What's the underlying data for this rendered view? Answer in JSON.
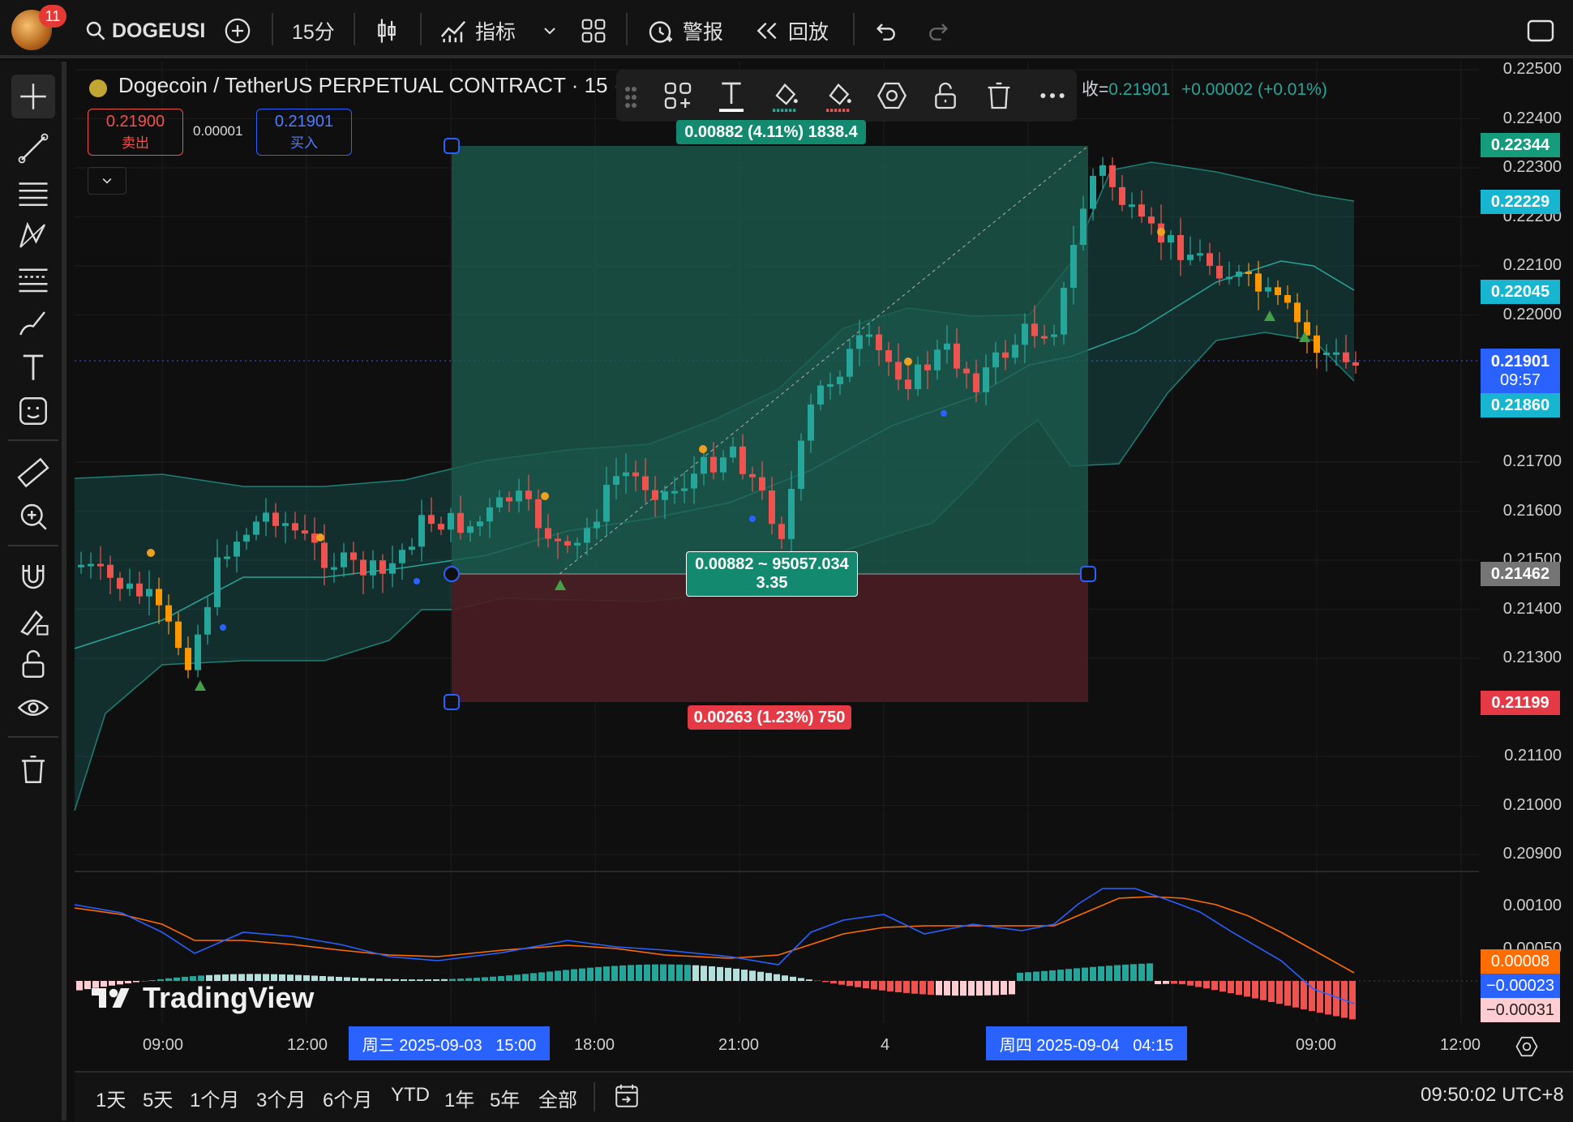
{
  "topbar": {
    "notification_count": "11",
    "symbol": "DOGEUSI",
    "interval": "15分",
    "indicators_label": "指标",
    "alert_label": "警报",
    "replay_label": "回放"
  },
  "legend": {
    "title": "Dogecoin / TetherUS PERPETUAL CONTRACT · 15 ·",
    "close_prefix": "收=",
    "close_value": "0.21901",
    "change": "+0.00002 (+0.01%)",
    "sell_price": "0.21900",
    "sell_label": "卖出",
    "spread": "0.00001",
    "buy_price": "0.21901",
    "buy_label": "买入"
  },
  "position_tool": {
    "target_label": "0.00882 (4.11%) 1838.4",
    "center_label_line1": "0.00882 ~ 95057.034",
    "center_label_line2": "3.35",
    "stop_label": "0.00263 (1.23%) 750"
  },
  "price_axis": {
    "ticks": [
      "0.22500",
      "0.22400",
      "0.22300",
      "0.22200",
      "0.22100",
      "0.22000",
      "0.21700",
      "0.21600",
      "0.21500",
      "0.21400",
      "0.21300",
      "0.21100",
      "0.21000",
      "0.20900"
    ],
    "tags": {
      "target": "0.22344",
      "bb_upper": "0.22229",
      "bb_mid": "0.22045",
      "last": "0.21901",
      "countdown": "09:57",
      "bb_lower": "0.21860",
      "entry": "0.21462",
      "stop": "0.21199"
    }
  },
  "macd_axis": {
    "ticks": [
      "0.00100",
      "0.00050"
    ],
    "tags": {
      "signal": "0.00008",
      "macd": "−0.00023",
      "hist": "−0.00031"
    }
  },
  "watermark": "TradingView",
  "time_axis": {
    "labels": [
      "09:00",
      "12:00",
      "18:00",
      "21:00",
      "4",
      "09:00",
      "12:00"
    ],
    "range_start": "周三 2025-09-03   15:00",
    "range_end": "周四 2025-09-04   04:15"
  },
  "bottombar": {
    "ranges": [
      "1天",
      "5天",
      "1个月",
      "3个月",
      "6个月",
      "YTD",
      "1年",
      "5年",
      "全部"
    ],
    "clock": "09:50:02 UTC+8"
  },
  "colors": {
    "up": "#26a69a",
    "down": "#ef5350",
    "profit_zone": "#1c5b4d",
    "loss_zone": "#4a1d22",
    "macd_line": "#2962ff",
    "signal_line": "#ff6d00"
  }
}
